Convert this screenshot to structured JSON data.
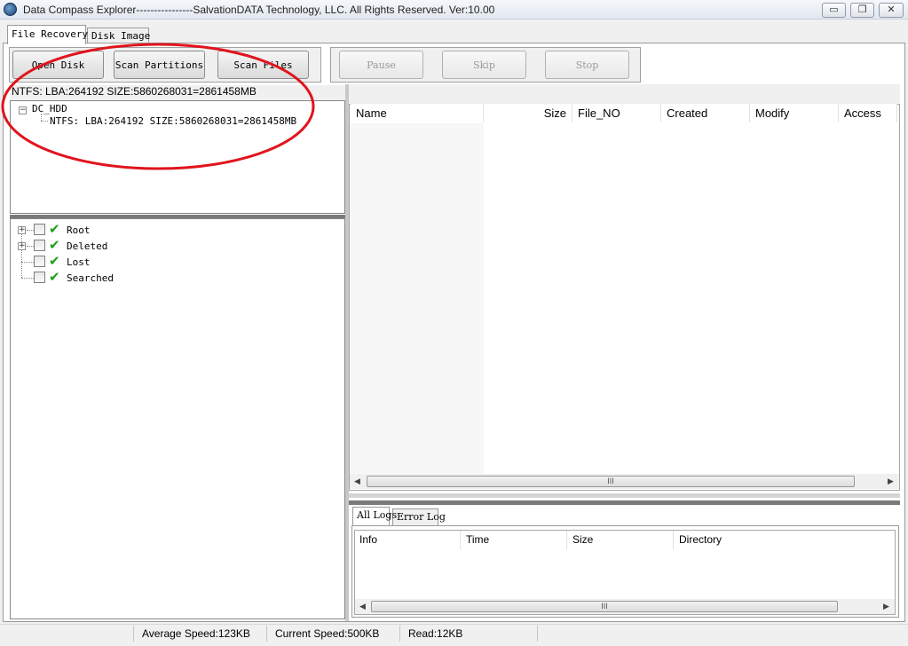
{
  "window": {
    "title": "Data Compass Explorer----------------SalvationDATA Technology, LLC. All Rights Reserved.   Ver:10.00",
    "controls": {
      "minimize": "▭",
      "restore": "❐",
      "close": "✕"
    }
  },
  "tabs": [
    {
      "label": "File Recovery",
      "active": true
    },
    {
      "label": "Disk Image",
      "active": false
    }
  ],
  "toolbar": {
    "open_disk": "Open Disk",
    "scan_partitions": "Scan Partitions",
    "scan_files": "Scan Files",
    "pause": "Pause",
    "skip": "Skip",
    "stop": "Stop"
  },
  "partition_panel": {
    "header": "NTFS: LBA:264192 SIZE:5860268031=2861458MB",
    "disk_node": "DC_HDD",
    "partition_node": "NTFS: LBA:264192 SIZE:5860268031=2861458MB"
  },
  "folder_tree": {
    "items": [
      {
        "label": "Root",
        "expandable": true
      },
      {
        "label": "Deleted",
        "expandable": true
      },
      {
        "label": "Lost",
        "expandable": false
      },
      {
        "label": "Searched",
        "expandable": false
      }
    ]
  },
  "file_list": {
    "columns": [
      "Name",
      "Size",
      "File_NO",
      "Created",
      "Modify",
      "Access"
    ],
    "rows": [],
    "scroll_thumb": "III"
  },
  "logs": {
    "tabs": [
      "All Logs",
      "Error Log"
    ],
    "columns": [
      "Info",
      "Time",
      "Size",
      "Directory"
    ],
    "rows": [],
    "scroll_thumb": "III"
  },
  "status_bar": {
    "average_speed": "Average Speed:123KB",
    "current_speed": "Current Speed:500KB",
    "read": "Read:12KB"
  },
  "colors": {
    "annotation_ellipse": "#e0141e",
    "check_tick": "#18a018"
  }
}
